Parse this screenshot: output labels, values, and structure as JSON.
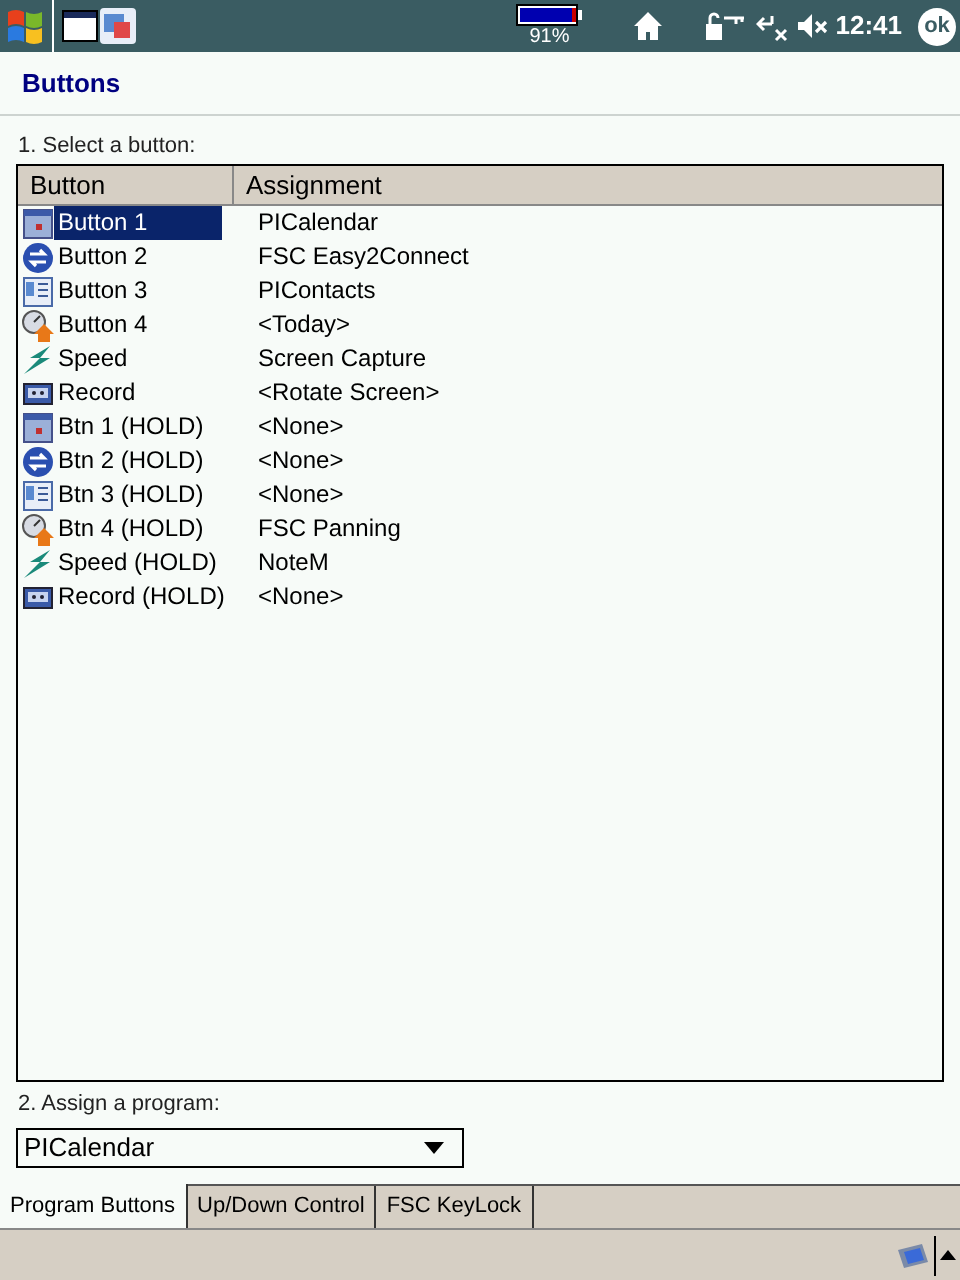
{
  "status_bar": {
    "battery_text": "91%",
    "time": "12:41",
    "ok_label": "ok"
  },
  "title": "Buttons",
  "select_label": "1. Select a button:",
  "list": {
    "columns": [
      "Button",
      "Assignment"
    ],
    "rows": [
      {
        "kind": "calendar",
        "button": "Button 1",
        "assignment": "PICalendar",
        "selected": true
      },
      {
        "kind": "sync",
        "button": "Button 2",
        "assignment": "FSC Easy2Connect",
        "selected": false
      },
      {
        "kind": "contacts",
        "button": "Button 3",
        "assignment": "PIContacts",
        "selected": false
      },
      {
        "kind": "today",
        "button": "Button 4",
        "assignment": "<Today>",
        "selected": false
      },
      {
        "kind": "speed",
        "button": "Speed",
        "assignment": "Screen Capture",
        "selected": false
      },
      {
        "kind": "record",
        "button": "Record",
        "assignment": "<Rotate Screen>",
        "selected": false
      },
      {
        "kind": "calendar",
        "button": "Btn 1 (HOLD)",
        "assignment": "<None>",
        "selected": false
      },
      {
        "kind": "sync",
        "button": "Btn 2 (HOLD)",
        "assignment": "<None>",
        "selected": false
      },
      {
        "kind": "contacts",
        "button": "Btn 3 (HOLD)",
        "assignment": "<None>",
        "selected": false
      },
      {
        "kind": "today",
        "button": "Btn 4 (HOLD)",
        "assignment": "FSC Panning",
        "selected": false
      },
      {
        "kind": "speed",
        "button": "Speed (HOLD)",
        "assignment": "NoteM",
        "selected": false
      },
      {
        "kind": "record",
        "button": "Record (HOLD)",
        "assignment": "<None>",
        "selected": false
      }
    ]
  },
  "assign_label": "2. Assign a program:",
  "program_dropdown": {
    "value": "PICalendar"
  },
  "tabs": [
    {
      "label": "Program Buttons",
      "selected": true
    },
    {
      "label": "Up/Down Control",
      "selected": false
    },
    {
      "label": "FSC KeyLock",
      "selected": false
    }
  ]
}
